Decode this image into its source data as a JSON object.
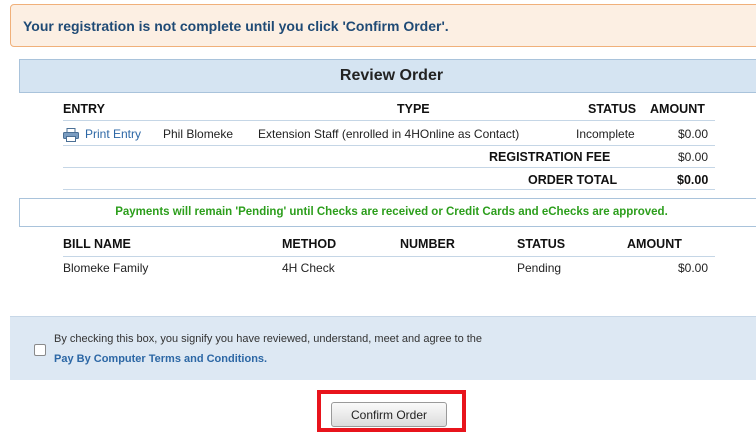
{
  "alert": {
    "message": "Your registration is not complete until you click 'Confirm Order'."
  },
  "review": {
    "title": "Review Order",
    "columns": {
      "entry": "ENTRY",
      "type": "TYPE",
      "status": "STATUS",
      "amount": "AMOUNT"
    },
    "row": {
      "print_label": "Print Entry",
      "name": "Phil Blomeke",
      "type": "Extension Staff (enrolled in 4HOnline as Contact)",
      "status": "Incomplete",
      "amount": "$0.00"
    },
    "registration_fee": {
      "label": "REGISTRATION FEE",
      "amount": "$0.00"
    },
    "order_total": {
      "label": "ORDER TOTAL",
      "amount": "$0.00"
    }
  },
  "payments_notice": "Payments will remain 'Pending' until Checks are received or Credit Cards and eChecks are approved.",
  "bills": {
    "columns": {
      "bill_name": "BILL NAME",
      "method": "METHOD",
      "number": "NUMBER",
      "status": "STATUS",
      "amount": "AMOUNT"
    },
    "row": {
      "bill_name": "Blomeke Family",
      "method": "4H Check",
      "number": "",
      "status": "Pending",
      "amount": "$0.00"
    }
  },
  "terms": {
    "text": "By checking this box, you signify you have reviewed, understand, meet and agree to the",
    "link": "Pay By Computer Terms and Conditions."
  },
  "confirm_button": "Confirm Order",
  "icons": {
    "print": "printer-icon"
  },
  "colors": {
    "link": "#2c67a5",
    "notice_green": "#2c9e1c",
    "highlight_red": "#e8141c",
    "header_bg": "#d5e4f2",
    "alert_bg": "#fcefe3"
  }
}
